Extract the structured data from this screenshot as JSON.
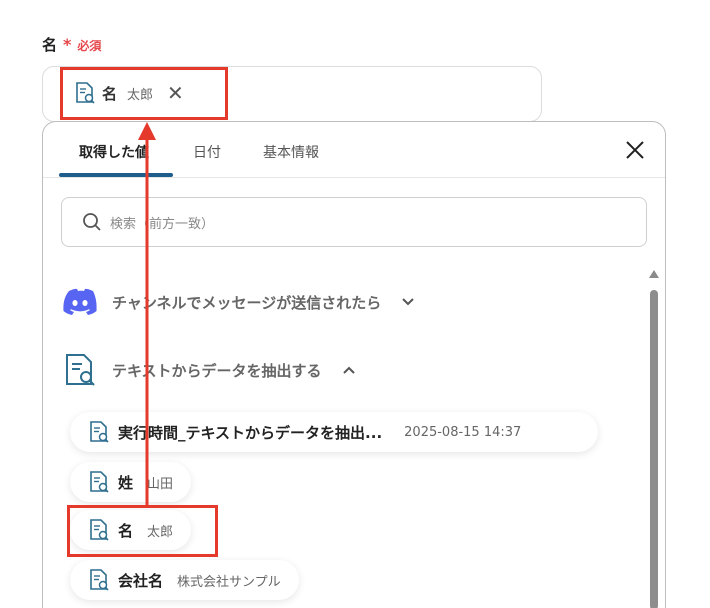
{
  "field": {
    "label": "名",
    "required_star": "*",
    "required_text": "必須",
    "chip": {
      "name": "名",
      "value": "太郎",
      "remove_glyph": "✕"
    }
  },
  "panel": {
    "tabs": [
      {
        "label": "取得した値",
        "active": true
      },
      {
        "label": "日付",
        "active": false
      },
      {
        "label": "基本情報",
        "active": false
      }
    ],
    "search_placeholder": "検索（前方一致）",
    "sections": [
      {
        "icon": "discord-icon",
        "label": "チャンネルでメッセージが送信されたら",
        "expanded": false
      },
      {
        "icon": "document-search-icon",
        "label": "テキストからデータを抽出する",
        "expanded": true
      }
    ],
    "items": [
      {
        "name": "実行時間_テキストからデータを抽出...",
        "value": "2025-08-15 14:37"
      },
      {
        "name": "姓",
        "value": "山田"
      },
      {
        "name": "名",
        "value": "太郎"
      },
      {
        "name": "会社名",
        "value": "株式会社サンプル"
      }
    ]
  },
  "colors": {
    "accent": "#1e5d8c",
    "highlight": "#e53a2b",
    "required": "#e5484d",
    "discord": "#5865f2"
  }
}
